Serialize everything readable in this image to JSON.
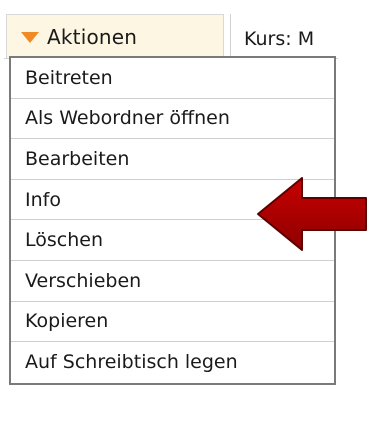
{
  "toolbar": {
    "actions_label": "Aktionen",
    "kurs_label": "Kurs: M",
    "actions_icon": "caret-down-icon",
    "accent_color": "#f08a24"
  },
  "menu": {
    "items": [
      {
        "label": "Beitreten"
      },
      {
        "label": "Als Webordner öffnen"
      },
      {
        "label": "Bearbeiten"
      },
      {
        "label": "Info"
      },
      {
        "label": "Löschen"
      },
      {
        "label": "Verschieben"
      },
      {
        "label": "Kopieren"
      },
      {
        "label": "Auf Schreibtisch legen"
      }
    ]
  },
  "annotation": {
    "icon": "red-arrow-left-icon",
    "color": "#b50000",
    "points_to": "Info"
  }
}
